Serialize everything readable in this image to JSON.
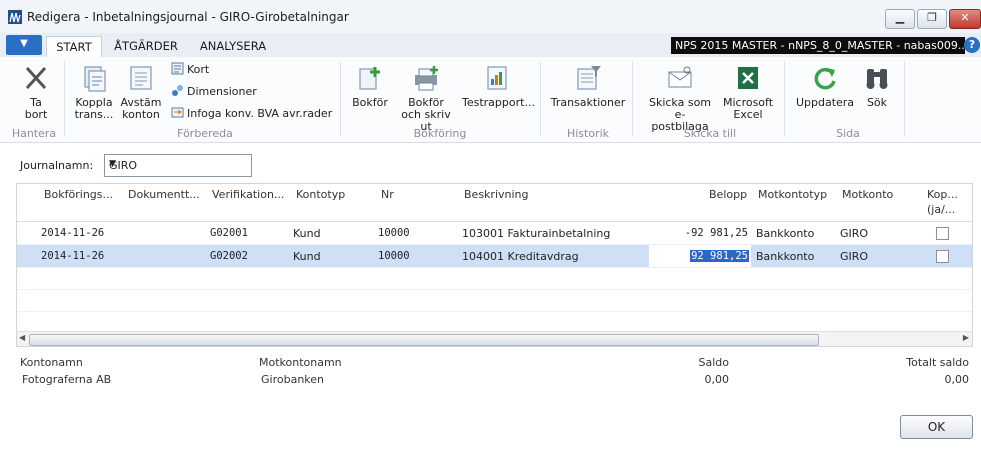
{
  "window": {
    "title": "Redigera - Inbetalningsjournal - GIRO-Girobetalningar",
    "minimize_icon": "minimize-icon",
    "restore_icon": "restore-icon",
    "close_icon": "close-icon"
  },
  "tabs": {
    "start": "START",
    "actions": "ÅTGÄRDER",
    "analyze": "ANALYSERA"
  },
  "company": "NPS 2015 MASTER - nNPS_8_0_MASTER - nabas009....",
  "ribbon": {
    "delete": "Ta bort",
    "delete_line2": "bort",
    "delete_line1": "Ta",
    "group_manage": "Hantera",
    "apply_line1": "Koppla",
    "apply_line2": "trans...",
    "reconcile_line1": "Avstäm",
    "reconcile_line2": "konton",
    "card": "Kort",
    "dimensions": "Dimensioner",
    "insert_conv": "Infoga konv. BVA avr.rader",
    "group_prepare": "Förbereda",
    "post": "Bokför",
    "post_print_line1": "Bokför",
    "post_print_line2": "och skriv ut",
    "test_report": "Testrapport...",
    "group_posting": "Bokföring",
    "transactions": "Transaktioner",
    "group_history": "Historik",
    "send_email_line1": "Skicka som e-",
    "send_email_line2": "postbilaga",
    "excel_line1": "Microsoft",
    "excel_line2": "Excel",
    "group_send": "Skicka till",
    "refresh": "Uppdatera",
    "find": "Sök",
    "group_page": "Sida"
  },
  "journal": {
    "label": "Journalnamn:",
    "value": "GIRO"
  },
  "grid": {
    "headers": {
      "posting_date": "Bokförings...",
      "document_type": "Dokumentt...",
      "document_no": "Verifikation...",
      "account_type": "Kontotyp",
      "account_no": "Nr",
      "description": "Beskrivning",
      "amount": "Belopp",
      "bal_account_type": "Motkontotyp",
      "bal_account_no": "Motkonto",
      "applied_line1": "Kop...",
      "applied_line2": "(ja/..."
    },
    "rows": [
      {
        "posting_date": "2014-11-26",
        "document_type": "",
        "document_no": "G02001",
        "account_type": "Kund",
        "account_no": "10000",
        "description": "103001 Fakturainbetalning",
        "amount": "-92 981,25",
        "bal_account_type": "Bankkonto",
        "bal_account_no": "GIRO",
        "applied": false
      },
      {
        "posting_date": "2014-11-26",
        "document_type": "",
        "document_no": "G02002",
        "account_type": "Kund",
        "account_no": "10000",
        "description": "104001 Kreditavdrag",
        "amount": "92 981,25",
        "bal_account_type": "Bankkonto",
        "bal_account_no": "GIRO",
        "applied": false
      }
    ]
  },
  "summary": {
    "account_name_label": "Kontonamn",
    "account_name": "Fotograferna AB",
    "bal_account_name_label": "Motkontonamn",
    "bal_account_name": "Girobanken",
    "balance_label": "Saldo",
    "balance": "0,00",
    "total_balance_label": "Totalt saldo",
    "total_balance": "0,00"
  },
  "footer": {
    "ok": "OK"
  }
}
